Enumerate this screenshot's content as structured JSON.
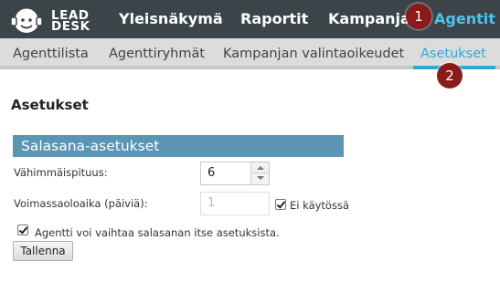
{
  "app": {
    "logo": {
      "line1": "LEAD",
      "line2": "DESK",
      "icon": "headset-face-icon"
    }
  },
  "top_nav": {
    "items": [
      {
        "label": "Yleisnäkymä"
      },
      {
        "label": "Raportit"
      },
      {
        "label": "Kampanjat"
      },
      {
        "label": "Agentit",
        "active": true
      }
    ]
  },
  "sub_nav": {
    "items": [
      {
        "label": "Agenttilista"
      },
      {
        "label": "Agenttiryhmät"
      },
      {
        "label": "Kampanjan valintaoikeudet"
      },
      {
        "label": "Asetukset",
        "active": true
      }
    ]
  },
  "badges": [
    "1",
    "2"
  ],
  "page": {
    "title": "Asetukset",
    "section_title": "Salasana-asetukset",
    "min_length": {
      "label": "Vähimmäispituus:",
      "value": "6"
    },
    "validity": {
      "label": "Voimassaoloaika (päiviä):",
      "value": "1",
      "disabled": true,
      "disabled_checkbox_label": "Ei käytössä",
      "disabled_checked": true
    },
    "agent_change": {
      "label": "Agentti voi vaihtaa salasanan itse asetuksista.",
      "checked": true
    },
    "save_label": "Tallenna"
  },
  "colors": {
    "topbar": "#3b4449",
    "active_nav": "#4fc3ef",
    "subbar": "#dcdcdc",
    "section_header": "#5b95b4",
    "badge": "#8b1a1a"
  }
}
